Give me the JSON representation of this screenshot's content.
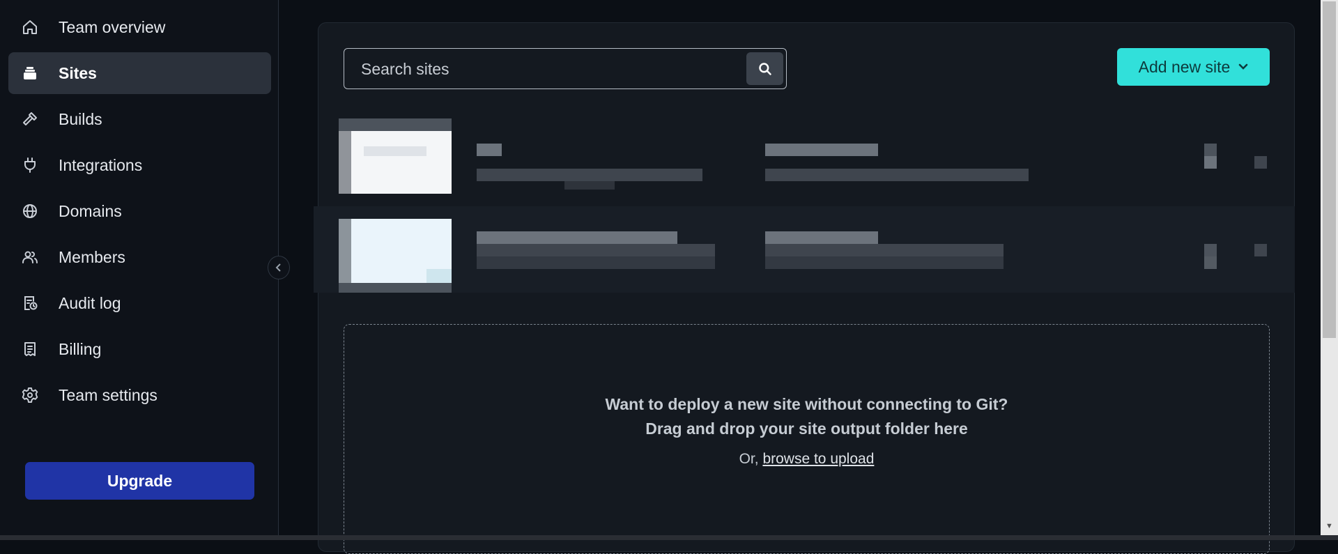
{
  "sidebar": {
    "items": [
      {
        "label": "Team overview",
        "icon": "home-icon"
      },
      {
        "label": "Sites",
        "icon": "layers-icon",
        "active": true
      },
      {
        "label": "Builds",
        "icon": "hammer-icon"
      },
      {
        "label": "Integrations",
        "icon": "plug-icon"
      },
      {
        "label": "Domains",
        "icon": "globe-icon"
      },
      {
        "label": "Members",
        "icon": "users-icon"
      },
      {
        "label": "Audit log",
        "icon": "audit-log-icon"
      },
      {
        "label": "Billing",
        "icon": "receipt-icon"
      },
      {
        "label": "Team settings",
        "icon": "gear-icon"
      }
    ],
    "upgrade_label": "Upgrade"
  },
  "search": {
    "placeholder": "Search sites"
  },
  "add_site": {
    "label": "Add new site"
  },
  "dropzone": {
    "line1": "Want to deploy a new site without connecting to Git?",
    "line2": "Drag and drop your site output folder here",
    "prefix": "Or, ",
    "link": "browse to upload"
  },
  "colors": {
    "accent": "#31e0da",
    "upgrade": "#2034a6",
    "active_nav": "#2b313b"
  }
}
